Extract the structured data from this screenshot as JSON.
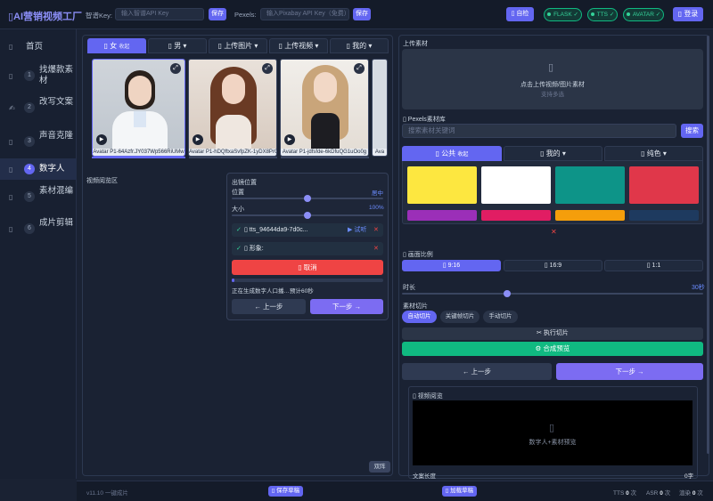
{
  "header": {
    "logo": "▯AI营销视频工厂",
    "zhipu_label": "智谱Key:",
    "zhipu_placeholder": "输入智谱API Key",
    "save1": "保存",
    "pexels_label": "Pexels:",
    "pexels_placeholder": "输入Pixabay API Key（免费）",
    "save2": "保存",
    "selfcheck": "▯ 自检",
    "pills": [
      "FLASK ✓",
      "TTS ✓",
      "AVATAR ✓"
    ],
    "login": "▯ 登录"
  },
  "sidebar": {
    "home": "首页",
    "items": [
      {
        "num": "1",
        "label": "找爆款素材"
      },
      {
        "num": "2",
        "label": "改写文案"
      },
      {
        "num": "3",
        "label": "声音克隆"
      },
      {
        "num": "4",
        "label": "数字人"
      },
      {
        "num": "5",
        "label": "素材混编"
      },
      {
        "num": "6",
        "label": "成片剪辑"
      }
    ]
  },
  "left": {
    "tabs": [
      {
        "label": "▯ 女",
        "sub": "收起"
      },
      {
        "label": "▯ 男 ▾"
      },
      {
        "label": "▯ 上传图片 ▾"
      },
      {
        "label": "▯ 上传视频 ▾"
      },
      {
        "label": "▯ 我的 ▾"
      }
    ],
    "avatars": [
      "Avatar P1-64Azfr.JY037Wp566RiUMw",
      "Avatar P1-hDQftxaSvfpZK-1yDX8PrQ",
      "Avatar P1-jdfsfde-6kDfuQG1uOo0g",
      "Ava"
    ],
    "preview_label": "视频阅览区",
    "dual": "双阵",
    "overlay": {
      "title": "出镜位置",
      "pos_label": "位置",
      "pos_value": "居中",
      "pos_fraction": 0.5,
      "size_label": "大小",
      "size_value": "100%",
      "size_fraction": 0.5,
      "tts_text": "▯ tts_94644da9-7d0c...",
      "tts_play": "▶ 试听",
      "shape_text": "▯ 形象:",
      "cancel": "▯ 取消",
      "progress_fraction": 0.02,
      "status": "正在生成数字人口播…预计60秒",
      "prev": "← 上一步",
      "next": "下一步 →"
    }
  },
  "right": {
    "upload_title": "上传素材",
    "upload_text": "点击上传视频/图片素材",
    "upload_sub": "支持多选",
    "pexels_title": "▯ Pexels素材库",
    "search_placeholder": "搜索素材关键词",
    "search_btn": "搜索",
    "tabs": [
      {
        "label": "▯ 公共",
        "sub": "收起"
      },
      {
        "label": "▯ 我的 ▾"
      },
      {
        "label": "▯ 纯色 ▾"
      }
    ],
    "swatches": [
      "#fde740",
      "#ffffff",
      "#0d9488",
      "#e0374a",
      "#9b2fb8",
      "#e11d63",
      "#f59e0b",
      "#1e3a5f"
    ],
    "clear": "✕",
    "ratio_title": "▯ 画面比例",
    "ratios": [
      "▯ 9:16",
      "▯ 16:9",
      "▯ 1:1"
    ],
    "duration_label": "时长",
    "duration_value": "30秒",
    "duration_fraction": 0.35,
    "cut_title": "素材切片",
    "cuts": [
      "自动切片",
      "关键帧切片",
      "手动切片"
    ],
    "exec_cut": "✂ 执行切片",
    "compose": "⚙ 合成预览",
    "prev": "← 上一步",
    "next": "下一步 →",
    "preview_title": "▯ 视频阅览",
    "preview_text": "数字人+素材预览",
    "copy_len_label": "文案长度",
    "copy_len_value": "0字"
  },
  "footer": {
    "version": "v11.10 一键成片",
    "save_draft": "▯ 保存草稿",
    "load_draft": "▯ 加载草稿",
    "stats": [
      {
        "label": "TTS",
        "value": "0",
        "unit": "次"
      },
      {
        "label": "ASR",
        "value": "0",
        "unit": "次"
      },
      {
        "label": "渲染",
        "value": "0",
        "unit": "次"
      }
    ]
  }
}
